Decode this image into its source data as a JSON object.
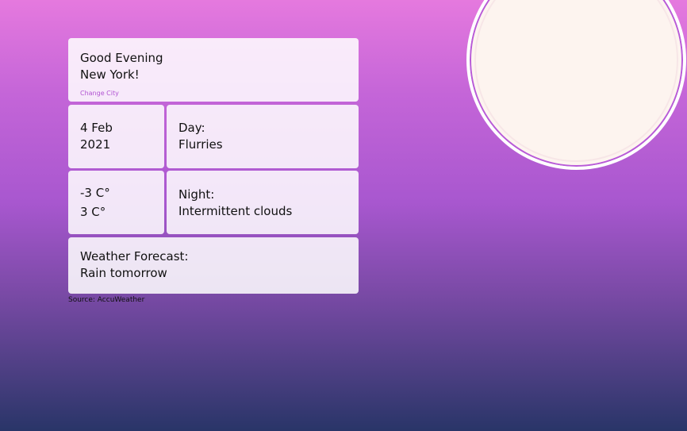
{
  "greeting": {
    "line1": "Good Evening",
    "line2": "New York!",
    "change_city": "Change City"
  },
  "date": {
    "day_month": "4 Feb",
    "year": "2021"
  },
  "day_forecast": {
    "label": "Day:",
    "value": "Flurries"
  },
  "temperatures": {
    "low": "-3 C°",
    "high": "3 C°"
  },
  "night_forecast": {
    "label": "Night:",
    "value": "Intermittent clouds"
  },
  "weather_forecast": {
    "label": "Weather Forecast:",
    "value": "Rain tomorrow"
  },
  "source": "Source: AccuWeather",
  "theme": {
    "gradient_top": "#e579de",
    "gradient_middle": "#a857cf",
    "gradient_bottom": "#293568",
    "card_background": "#ffffff",
    "link_color": "#b154d2",
    "moon_color": "#fdf4ef"
  },
  "icons": {
    "moon": "moon-icon"
  }
}
